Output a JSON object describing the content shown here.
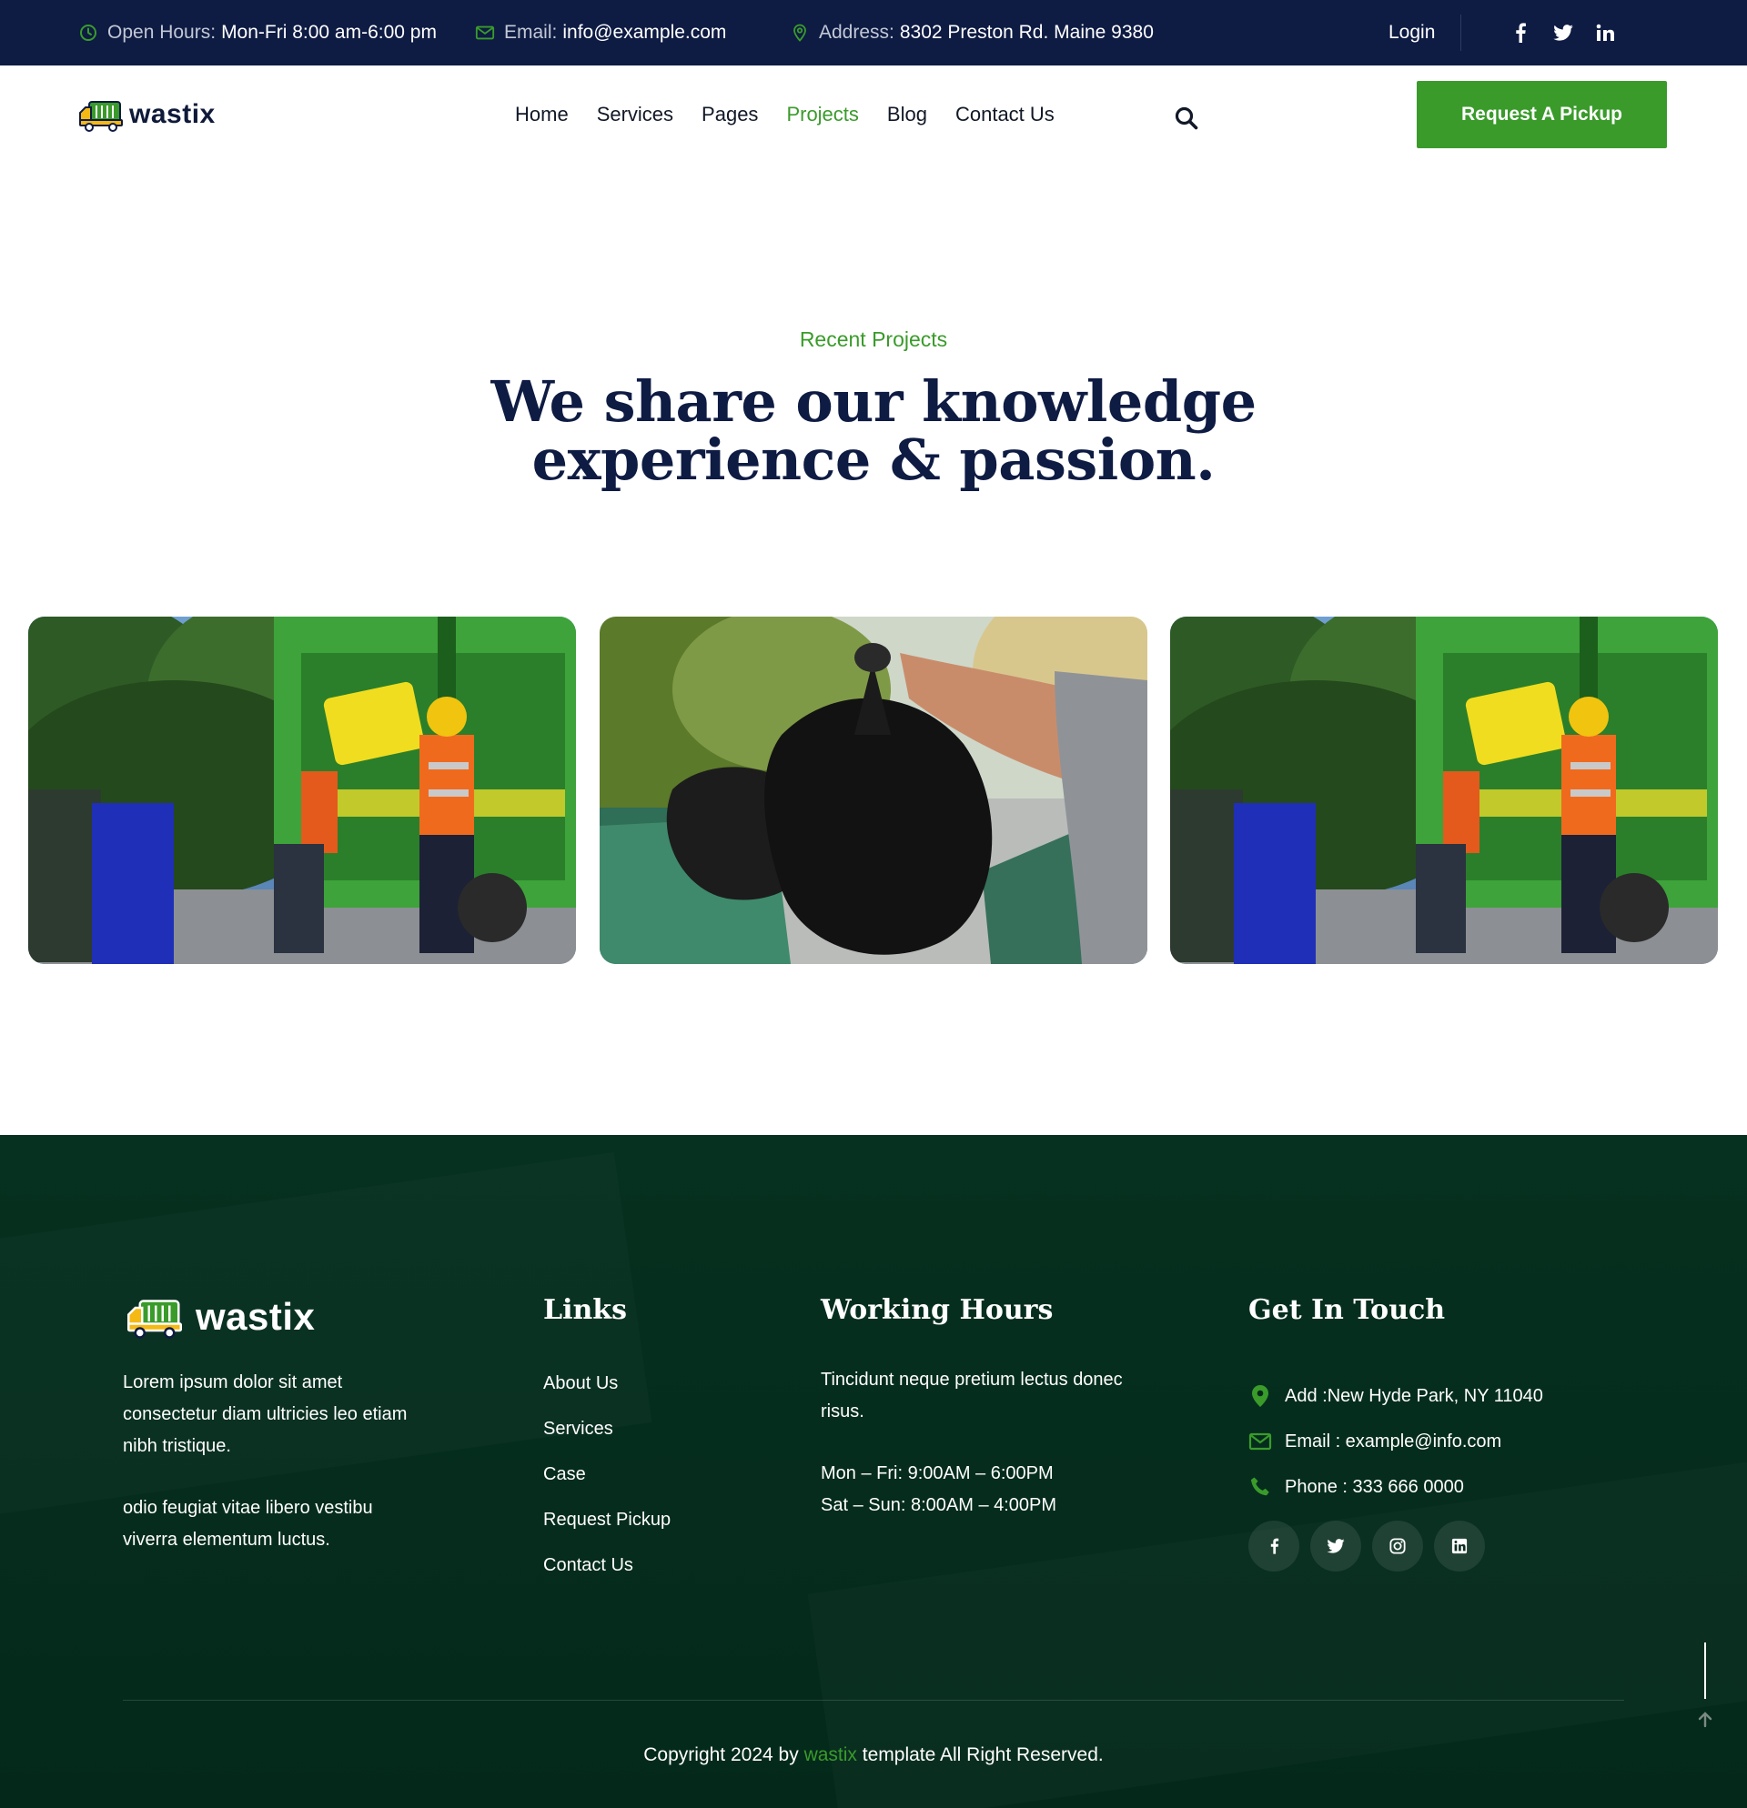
{
  "topbar": {
    "hours_label": "Open Hours:",
    "hours_value": "Mon-Fri 8:00 am-6:00 pm",
    "email_label": "Email:",
    "email_value": "info@example.com",
    "address_label": "Address:",
    "address_value": "8302 Preston Rd. Maine 9380",
    "login": "Login",
    "social": [
      "f",
      "twitter",
      "in"
    ]
  },
  "header": {
    "logo_text": "wastix",
    "nav": [
      "Home",
      "Services",
      "Pages",
      "Projects",
      "Blog",
      "Contact Us"
    ],
    "active_nav": "Projects",
    "cta": "Request A Pickup"
  },
  "section": {
    "eyebrow": "Recent Projects",
    "headline_line1": "We share our knowledge",
    "headline_line2": "experience & passion."
  },
  "projects": [
    {
      "image": "workers-loading-yellow-bin-into-green-garbage-truck"
    },
    {
      "image": "hand-holding-black-trash-bag-over-green-bins"
    },
    {
      "image": "workers-loading-yellow-bin-into-green-garbage-truck"
    }
  ],
  "footer": {
    "logo_text": "wastix",
    "about_p1": "Lorem ipsum dolor sit amet consectetur diam ultricies leo etiam nibh tristique.",
    "about_p2": "odio feugiat vitae libero vestibu viverra elementum luctus.",
    "links_title": "Links",
    "links": [
      "About Us",
      "Services",
      "Case",
      "Request Pickup",
      "Contact Us"
    ],
    "hours_title": "Working Hours",
    "hours_text": "Tincidunt neque pretium lectus donec risus.",
    "hours_weekday": "Mon – Fri: 9:00AM – 6:00PM",
    "hours_weekend": "Sat – Sun: 8:00AM – 4:00PM",
    "touch_title": "Get In Touch",
    "address": "Add :New Hyde Park, NY 11040",
    "email": "Email : example@info.com",
    "phone": "Phone : 333 666 0000",
    "social": [
      "facebook",
      "twitter",
      "instagram",
      "linkedin"
    ],
    "copyright_pre": "Copyright 2024 by",
    "copyright_brand": "wastix",
    "copyright_post": "template All Right Reserved."
  },
  "colors": {
    "navy": "#0e1b43",
    "green": "#3a9b2b",
    "footer_bg": "#04291b"
  }
}
